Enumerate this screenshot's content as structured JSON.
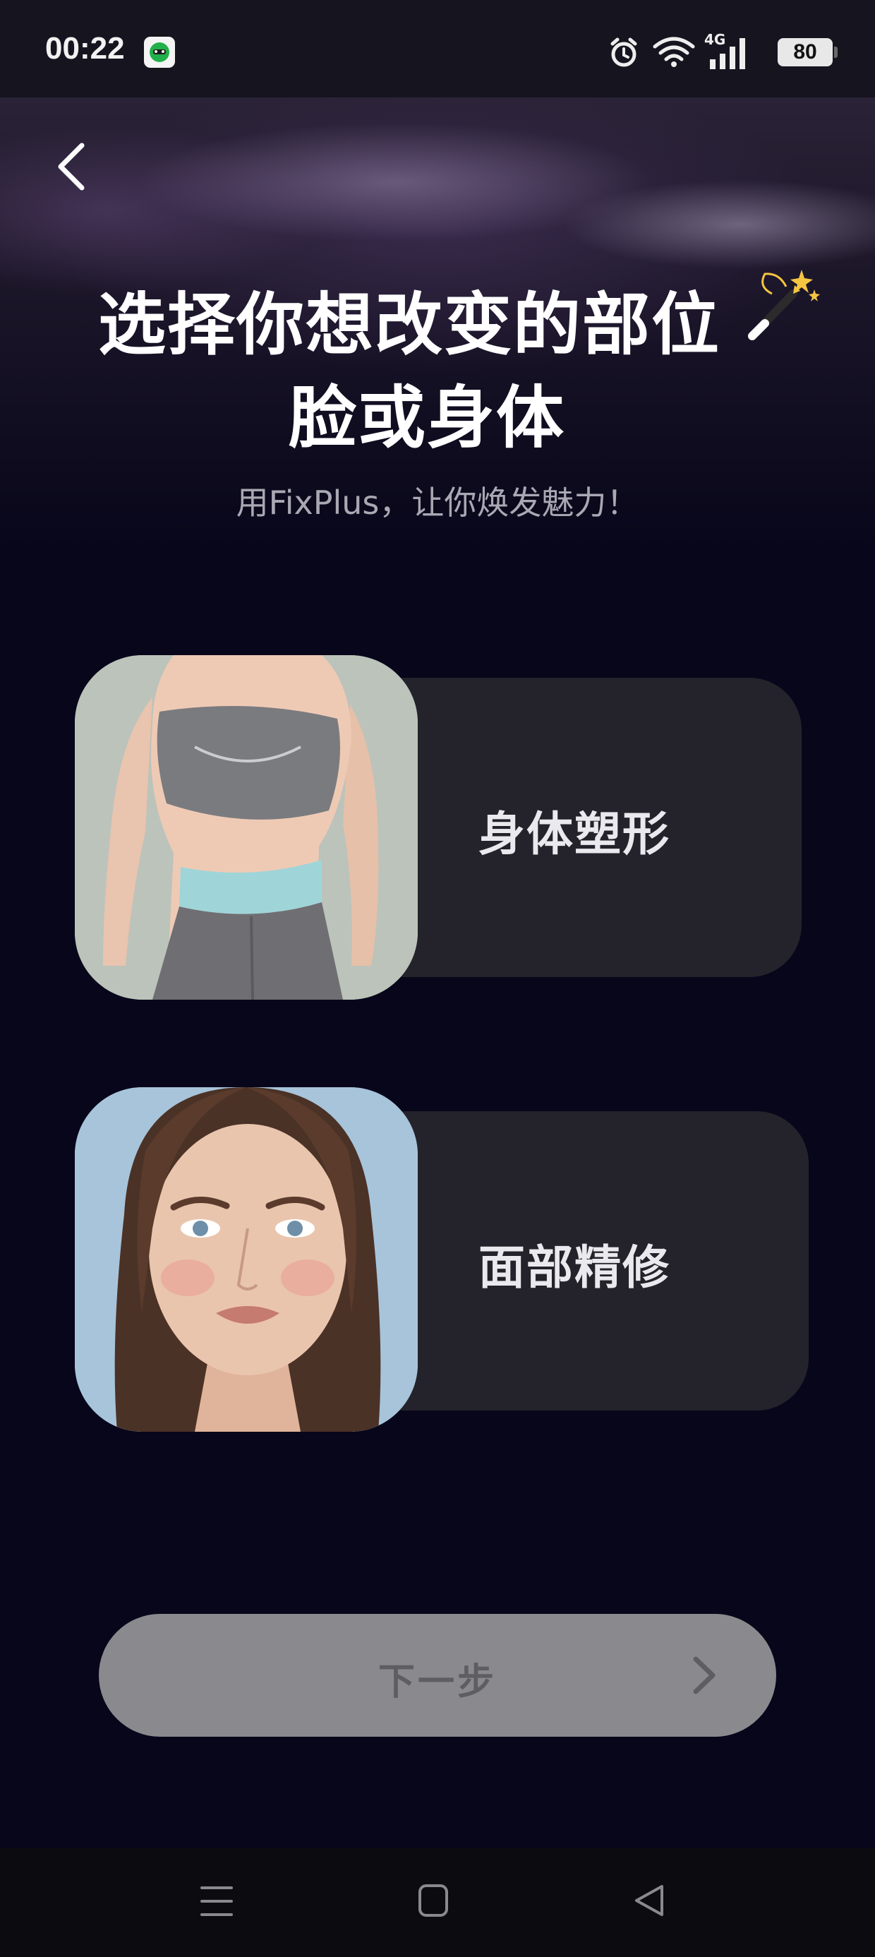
{
  "status_bar": {
    "time": "00:22",
    "network": "4G",
    "battery": "80",
    "icons": [
      "app-notification-icon",
      "alarm-icon",
      "wifi-icon",
      "signal-icon",
      "battery-icon"
    ]
  },
  "header": {
    "back_icon": "chevron-left-icon",
    "title_line1": "选择你想改变的部位",
    "title_emoji": "magic-wand-icon",
    "title_line2": "脸或身体",
    "subtitle": "用FixPlus，让你焕发魅力！"
  },
  "options": [
    {
      "label": "身体塑形",
      "image": "body-model-photo"
    },
    {
      "label": "面部精修",
      "image": "face-model-photo"
    }
  ],
  "next_button": {
    "label": "下一步",
    "icon": "chevron-right-icon",
    "enabled": false
  },
  "nav_bar": {
    "icons": [
      "menu-icon",
      "home-icon",
      "back-triangle-icon"
    ]
  }
}
